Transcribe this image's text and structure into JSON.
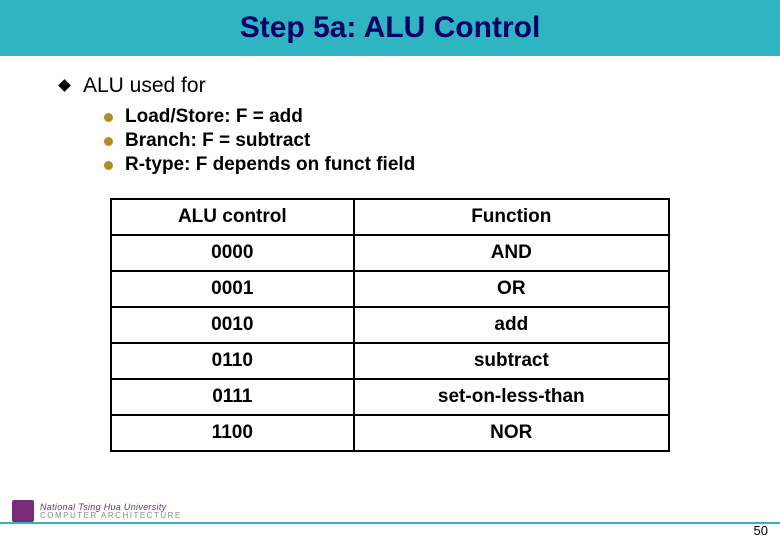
{
  "title": "Step 5a: ALU Control",
  "heading": "ALU used for",
  "bullets": [
    "Load/Store: F = add",
    "Branch: F = subtract",
    "R-type: F depends on funct field"
  ],
  "table": {
    "headers": [
      "ALU control",
      "Function"
    ],
    "rows": [
      [
        "0000",
        "AND"
      ],
      [
        "0001",
        "OR"
      ],
      [
        "0010",
        "add"
      ],
      [
        "0110",
        "subtract"
      ],
      [
        "0111",
        "set-on-less-than"
      ],
      [
        "1100",
        "NOR"
      ]
    ]
  },
  "footer": {
    "university": "National Tsing Hua University",
    "dept": "COMPUTER ARCHITECTURE",
    "page": "50"
  },
  "chart_data": {
    "type": "table",
    "title": "ALU Control Function Mapping",
    "columns": [
      "ALU control",
      "Function"
    ],
    "rows": [
      {
        "ALU control": "0000",
        "Function": "AND"
      },
      {
        "ALU control": "0001",
        "Function": "OR"
      },
      {
        "ALU control": "0010",
        "Function": "add"
      },
      {
        "ALU control": "0110",
        "Function": "subtract"
      },
      {
        "ALU control": "0111",
        "Function": "set-on-less-than"
      },
      {
        "ALU control": "1100",
        "Function": "NOR"
      }
    ]
  }
}
